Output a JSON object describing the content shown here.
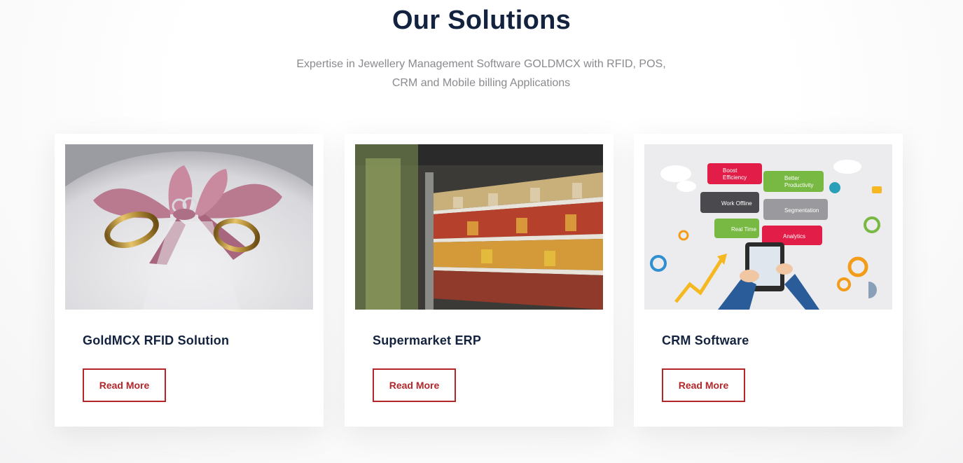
{
  "section": {
    "title": "Our Solutions",
    "subtitle_line1": "Expertise in Jewellery Management Software GOLDMCX with RFID, POS,",
    "subtitle_line2": "CRM and Mobile billing Applications"
  },
  "cards": [
    {
      "title": "GoldMCX RFID Solution",
      "button": "Read More",
      "image": "wedding-rings-photo"
    },
    {
      "title": "Supermarket ERP",
      "button": "Read More",
      "image": "supermarket-shelves-photo"
    },
    {
      "title": "CRM Software",
      "button": "Read More",
      "image": "crm-features-illustration"
    }
  ],
  "crm_labels": {
    "boost": [
      "Boost",
      "Efficiency"
    ],
    "better": [
      "Better",
      "Productivity"
    ],
    "work_offline": "Work Offline",
    "segmentation": "Segmentation",
    "real_time": "Real Time",
    "analytics": "Analytics"
  },
  "colors": {
    "title": "#13233f",
    "subtitle": "#8a8a8f",
    "accent": "#b3272a",
    "card_bg": "#ffffff"
  }
}
